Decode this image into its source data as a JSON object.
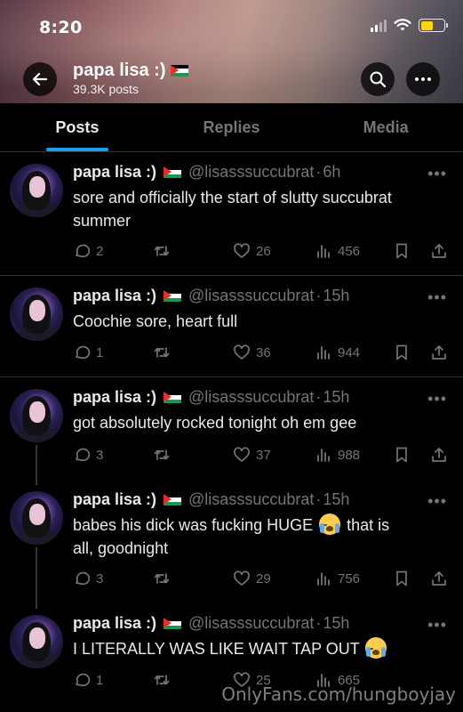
{
  "status": {
    "time": "8:20"
  },
  "profile": {
    "name": "papa lisa :)",
    "posts_count": "39.3K posts"
  },
  "tabs": [
    {
      "label": "Posts",
      "active": true
    },
    {
      "label": "Replies",
      "active": false
    },
    {
      "label": "Media",
      "active": false
    }
  ],
  "posts": [
    {
      "name": "papa lisa :)",
      "handle": "@lisasssuccubrat",
      "time": "6h",
      "text_lines": [
        "sore and officially the start of slutty succubrat",
        "summer"
      ],
      "replies": "2",
      "reposts": "",
      "likes": "26",
      "views": "456"
    },
    {
      "name": "papa lisa :)",
      "handle": "@lisasssuccubrat",
      "time": "15h",
      "text_lines": [
        "Coochie sore, heart full"
      ],
      "replies": "1",
      "reposts": "",
      "likes": "36",
      "views": "944"
    },
    {
      "name": "papa lisa :)",
      "handle": "@lisasssuccubrat",
      "time": "15h",
      "text_lines": [
        "got absolutely rocked tonight oh em gee"
      ],
      "replies": "3",
      "reposts": "",
      "likes": "37",
      "views": "988"
    },
    {
      "name": "papa lisa :)",
      "handle": "@lisasssuccubrat",
      "time": "15h",
      "text_lines": [
        "babes his dick was fucking HUGE",
        "that is",
        "all, goodnight"
      ],
      "replies": "3",
      "reposts": "",
      "likes": "29",
      "views": "756"
    },
    {
      "name": "papa lisa :)",
      "handle": "@lisasssuccubrat",
      "time": "15h",
      "text_lines": [
        "I LITERALLY WAS LIKE WAIT TAP OUT"
      ],
      "replies": "1",
      "reposts": "",
      "likes": "25",
      "views": "665"
    }
  ],
  "watermark": "OnlyFans.com/hungboyjay",
  "colors": {
    "accent": "#1d9bf0",
    "muted": "#71767b",
    "text": "#e7e9ea",
    "divider": "#2f3336"
  },
  "icons": [
    "back-arrow-icon",
    "search-icon",
    "more-icon",
    "reply-icon",
    "repost-icon",
    "like-icon",
    "views-icon",
    "bookmark-icon",
    "share-icon",
    "flag-emoji-icon",
    "crying-emoji-icon"
  ]
}
